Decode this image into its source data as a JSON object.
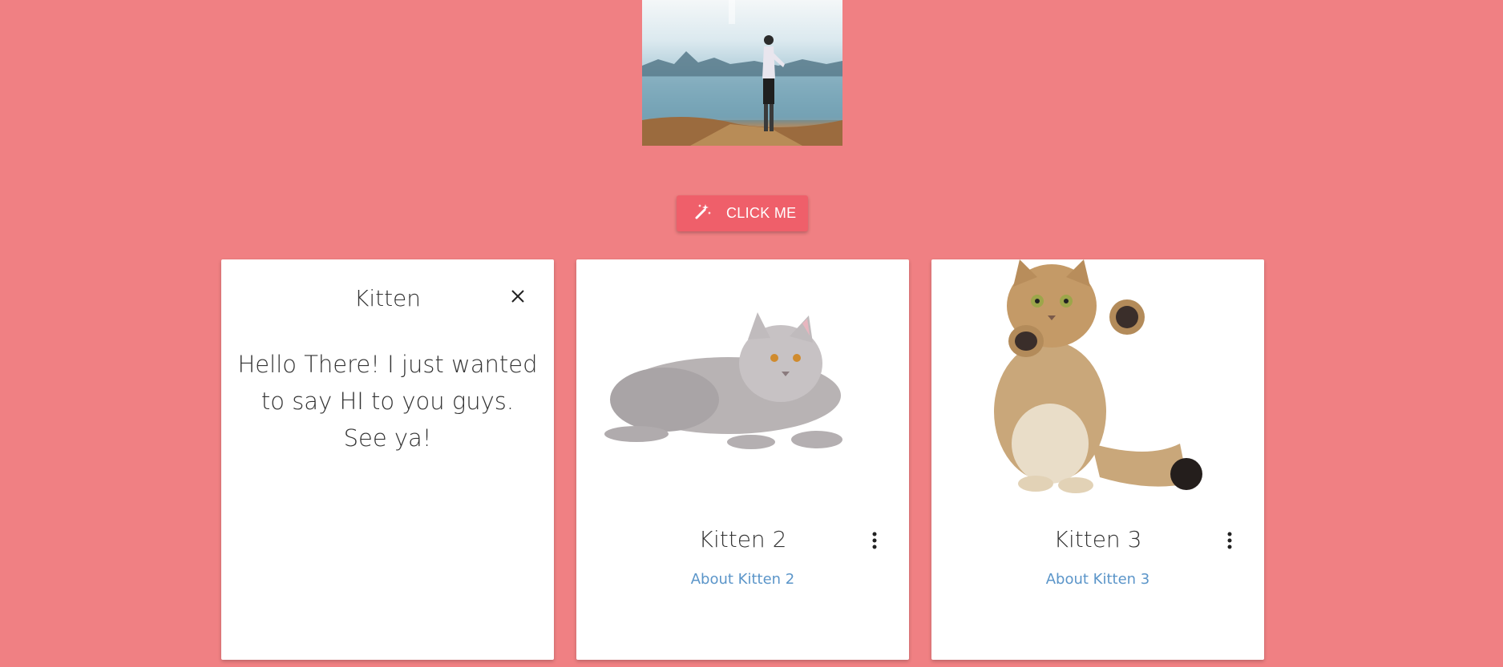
{
  "button": {
    "label": "CLICK ME",
    "icon": "magic-wand-icon"
  },
  "cards": [
    {
      "title": "Kitten",
      "text": "Hello There! I just wanted to say HI to you guys. See ya!",
      "close_icon": "close-icon"
    },
    {
      "title": "Kitten 2",
      "link": "About Kitten 2",
      "menu_icon": "more-vert-icon"
    },
    {
      "title": "Kitten 3",
      "link": "About Kitten 3",
      "menu_icon": "more-vert-icon"
    }
  ],
  "colors": {
    "background": "#f08083",
    "button": "#ef5f6a",
    "link": "#5b95c9"
  }
}
